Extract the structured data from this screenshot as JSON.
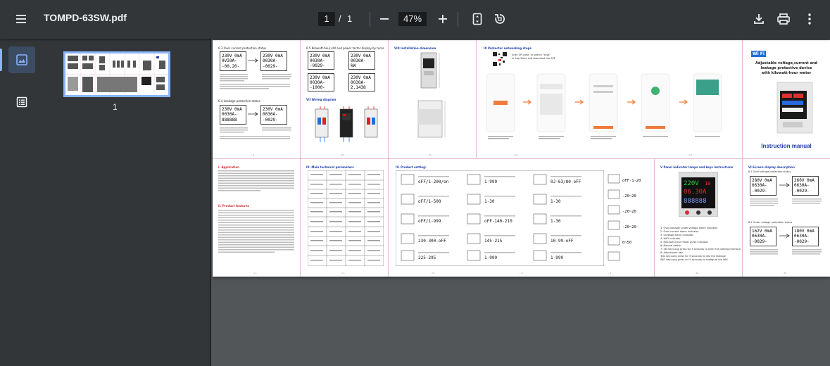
{
  "toolbar": {
    "title": "TOMPD-63SW.pdf",
    "current_page": "1",
    "page_separator": "/",
    "total_pages": "1",
    "zoom": "47%"
  },
  "sidebar": {
    "thumbnail_page_number": "1"
  },
  "document": {
    "panels": {
      "p63_title": "6.3 Over current protection status",
      "p64_title": "6.4 Leakage protection status",
      "p65_title": "6.5 Kilowatt-hour,kW and power factor display by turns",
      "p7_title": "VII Wiring diagram",
      "p8_title": "VIII Installation dimension",
      "p9_title": "IX Protector networking steps",
      "p9_sub1": "Scan QR code, or search \"tuya\"",
      "p9_sub2": "in App Store and download the APP",
      "cover_line1": "Adjustable voltage,current and",
      "cover_line2": "leakage protective device",
      "cover_line3": "with kilowatt-hour meter",
      "cover_manual": "Instruction manual",
      "cover_wifi": "Wi Fi",
      "p1_title": "I. Application",
      "p2_title": "II. Product features",
      "p3_title": "III. Main technical parameters",
      "p4_title": "IV. Product setting:",
      "p5_title": "V Panel indicator lamps and keys instructions",
      "p6_title": "VI.Screen display description",
      "p61_title": "6.1 Over voltage protection status",
      "p62_title": "6.2 Under voltage protection status",
      "table_headers": [
        "Function",
        "Technical Parameter",
        "Function",
        "Technical Parameter"
      ],
      "table_rows": [
        [
          "Rated voltage",
          "AC 140-300V",
          "Power-on delay time",
          "1-999s default 3s"
        ],
        [
          "Screen bright time",
          "1-999s default 30s",
          "Display interval delay time",
          "1-999s default 2s"
        ],
        [
          "Over-voltage protection value",
          "220-300V default 270V",
          "Over-voltage recovery value",
          "225-295V default 265V"
        ],
        [
          "Under-voltage protection value",
          "140-215V default 170V",
          "Under-voltage recovery value",
          "145-215V default 175V"
        ],
        [
          "Over-current protection value",
          "63A:4-63A default 63A",
          "Over-current",
          "0.4-63.0A"
        ],
        [
          "Leakage protection value",
          "0-99mA default 30mA",
          "Continuous over-current leakage",
          "1-30 times"
        ],
        [
          "Recovery delay time",
          "1-999s default 30s",
          "Action time",
          "<0.1s"
        ],
        [
          "Voltage/current/ kW calibration",
          "-20%-20%",
          "Power consumption",
          "<1W"
        ],
        [
          "Electrical and mechanical life",
          "≥100000 times",
          "Boundary dimension",
          "35×83×66mm"
        ]
      ],
      "settings": [
        "Screen bright time S  oFF/1-200/on",
        "Display interval delay time S  oFF/1-500",
        "Power-on delay time S  oFF/1-999",
        "Over-voltage protection value V  230-300-oFF",
        "Over-voltage recovery value V  225-295",
        "Over-voltage recovery delay time S  1-999",
        "Under-voltage protection value V  1-30",
        "Under-voltage protection value V  oFF-140-210",
        "Under-voltage recovery value V  145-215",
        "Under-voltage recovery delay time S  1-999",
        "Under-voltage recovery value S  1-30",
        "Over-current protection value A  0J-63/80-oFF",
        "Over-current recovery delay time S  1-30",
        "Continuous over-current faults times  1-30",
        "Leakage protection value mA  10-99-oFF",
        "Leakage recovery delay time S  1-999"
      ],
      "p5_list": [
        "1: Over-voltage/ under-voltage alarm indicator",
        "2: Over-current alarm indicator",
        "3: Leakage alarm indicator",
        "4: WIFI indicator",
        "5: Kilo-watt-hour meter pulse indicator",
        "6: Manual switch",
        "7: Set key:Long press for 3 seconds to enter the setting interface",
        "8: Adjustment key",
        "Test key:Long press for 3 seconds to test the leakage",
        "WiFi key:Long press for 5 seconds to configure the Wifi"
      ],
      "footers": [
        "- 9 -",
        "- 10 -",
        "- 11 -",
        "- 12 -",
        "- 13 -",
        "- 14 -",
        "- 1 -",
        "- 2 -",
        "- 3 -",
        "- 4 -",
        "- 5 -",
        "- 6 -",
        "- 7 -",
        "- 8 -"
      ]
    }
  }
}
